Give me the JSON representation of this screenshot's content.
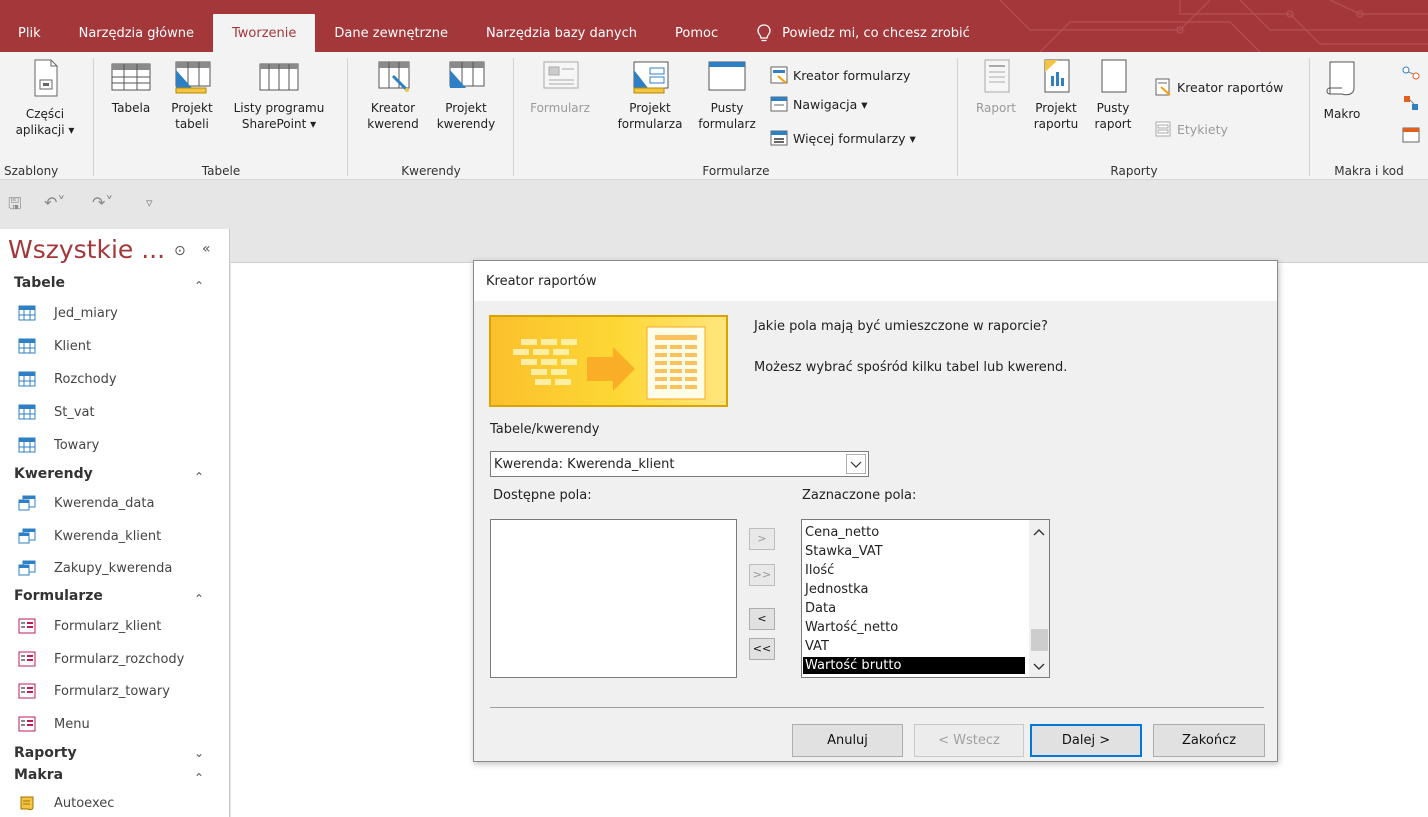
{
  "tabs": [
    "Plik",
    "Narzędzia główne",
    "Tworzenie",
    "Dane zewnętrzne",
    "Narzędzia bazy danych",
    "Pomoc"
  ],
  "tell_me": "Powiedz mi, co chcesz zrobić",
  "active_tab": "Tworzenie",
  "ribbon": {
    "szablony": {
      "label": "Szablony",
      "czesci_line1": "Części",
      "czesci_line2": "aplikacji ▾"
    },
    "tabele": {
      "label": "Tabele",
      "tabela": "Tabela",
      "projekt_line1": "Projekt",
      "projekt_line2": "tabeli",
      "listy_line1": "Listy programu",
      "listy_line2": "SharePoint ▾"
    },
    "kwerendy": {
      "label": "Kwerendy",
      "kreator_line1": "Kreator",
      "kreator_line2": "kwerend",
      "projekt_line1": "Projekt",
      "projekt_line2": "kwerendy"
    },
    "formularze": {
      "label": "Formularze",
      "formularz": "Formularz",
      "projekt_line1": "Projekt",
      "projekt_line2": "formularza",
      "pusty_line1": "Pusty",
      "pusty_line2": "formularz",
      "kreator": "Kreator formularzy",
      "nawigacja": "Nawigacja ▾",
      "wiecej": "Więcej formularzy ▾"
    },
    "raporty": {
      "label": "Raporty",
      "raport": "Raport",
      "projekt_line1": "Projekt",
      "projekt_line2": "raportu",
      "pusty_line1": "Pusty",
      "pusty_line2": "raport",
      "kreator": "Kreator raportów",
      "etykiety": "Etykiety"
    },
    "makra": {
      "label": "Makra i kod",
      "makro": "Makro"
    }
  },
  "nav": {
    "title": "Wszystkie ...",
    "groups": [
      {
        "name": "Tabele",
        "chevron": "≈",
        "items": [
          "Jed_miary",
          "Klient",
          "Rozchody",
          "St_vat",
          "Towary"
        ]
      },
      {
        "name": "Kwerendy",
        "chevron": "≈",
        "items": [
          "Kwerenda_data",
          "Kwerenda_klient",
          "Zakupy_kwerenda"
        ]
      },
      {
        "name": "Formularze",
        "chevron": "≈",
        "items": [
          "Formularz_klient",
          "Formularz_rozchody",
          "Formularz_towary",
          "Menu"
        ]
      },
      {
        "name": "Raporty",
        "chevron": "≈",
        "items": []
      },
      {
        "name": "Makra",
        "chevron": "≈",
        "items": [
          "Autoexec"
        ]
      }
    ]
  },
  "dialog": {
    "title": "Kreator raportów",
    "question": "Jakie pola mają być umieszczone w raporcie?",
    "hint": "Możesz wybrać spośród kilku tabel lub kwerend.",
    "tables_label": "Tabele/kwerendy",
    "combo_value": "Kwerenda: Kwerenda_klient",
    "available_label": "Dostępne pola:",
    "selected_label": "Zaznaczone pola:",
    "selected_fields": [
      "Cena_netto",
      "Stawka_VAT",
      "Ilość",
      "Jednostka",
      "Data",
      "Wartość_netto",
      "VAT",
      "Wartość brutto"
    ],
    "selected_index": 7,
    "move_buttons": [
      ">",
      ">>",
      "<",
      "<<"
    ],
    "buttons": {
      "cancel": "Anuluj",
      "back": "< Wstecz",
      "next": "Dalej >",
      "finish": "Zakończ"
    }
  },
  "colors": {
    "accent": "#a4373a",
    "ribbon_bg": "#f3f3f3",
    "focus": "#0078d7"
  }
}
